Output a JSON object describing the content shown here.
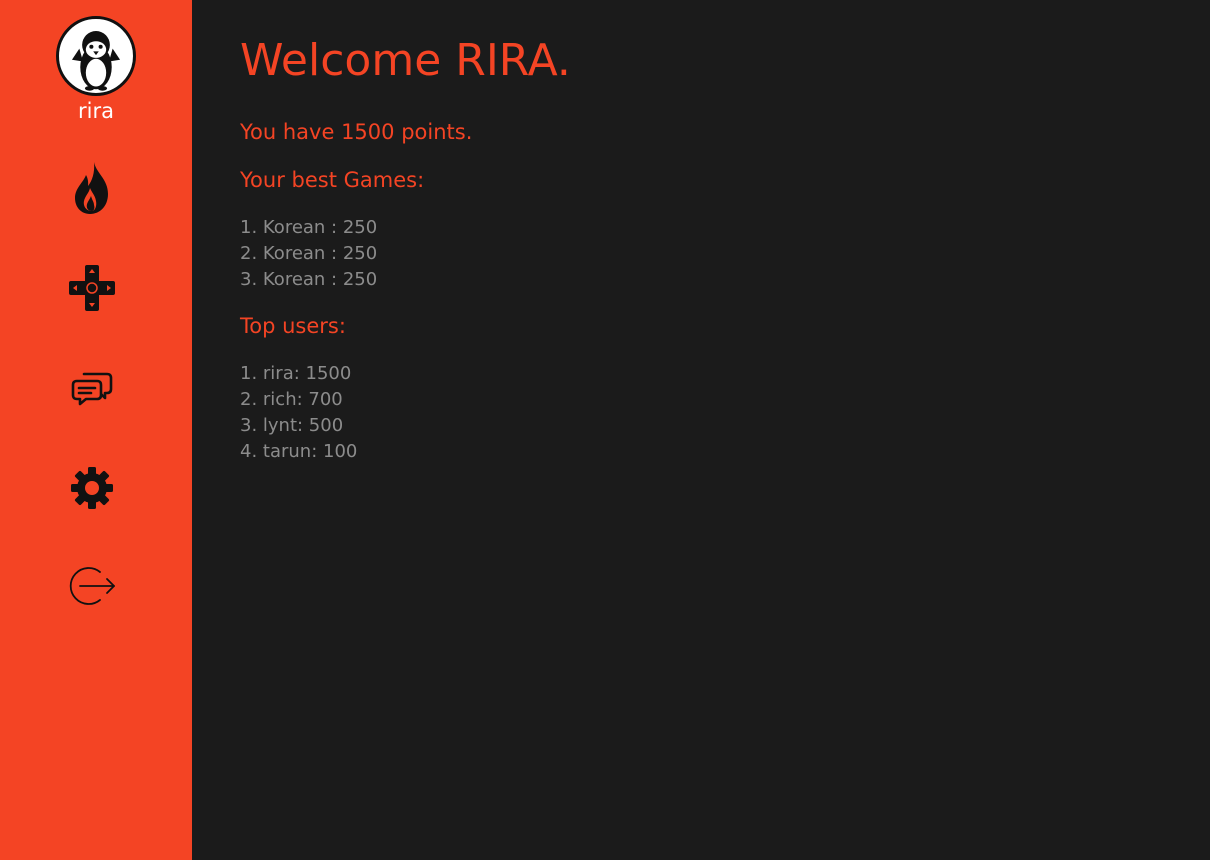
{
  "user": {
    "username": "rira"
  },
  "nav": [
    {
      "icon": "fire-icon"
    },
    {
      "icon": "gamepad-icon"
    },
    {
      "icon": "chat-icon"
    },
    {
      "icon": "gear-icon"
    },
    {
      "icon": "logout-icon"
    }
  ],
  "main": {
    "title": "Welcome RIRA.",
    "points_text": "You have 1500 points.",
    "best_games_title": "Your best Games:",
    "best_games": [
      "1. Korean : 250",
      "2. Korean : 250",
      "3. Korean : 250"
    ],
    "top_users_title": "Top users:",
    "top_users": [
      "1. rira: 1500",
      "2. rich: 700",
      "3. lynt: 500",
      "4. tarun: 100"
    ]
  },
  "colors": {
    "accent": "#f44424",
    "background": "#1b1b1b",
    "muted_text": "#8c8c8c",
    "icon": "#111111"
  }
}
